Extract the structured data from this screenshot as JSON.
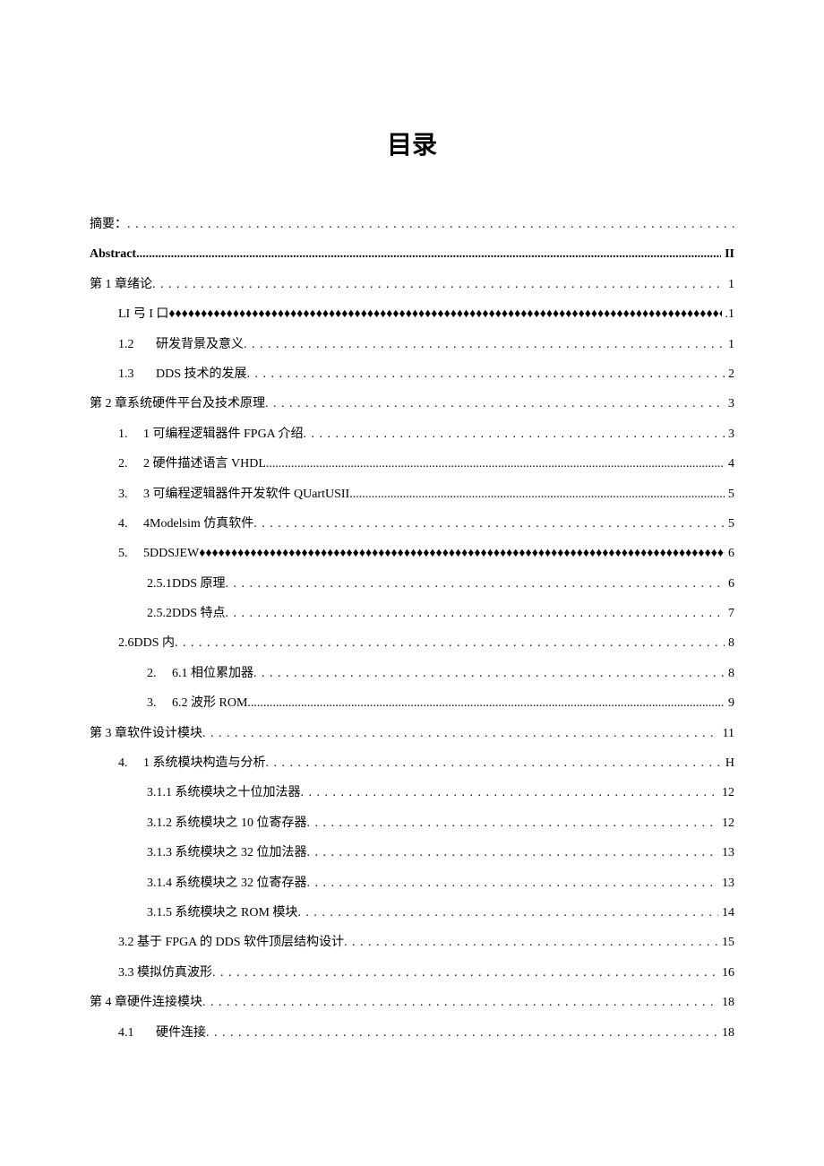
{
  "title": "目录",
  "entries": {
    "abstract_zh": "摘要：",
    "abstract_en": "Abstract",
    "abstract_en_page": "II",
    "ch1": "第 1 章绪论",
    "ch1_page": "1",
    "ch1_1": "LI 弓 I 口",
    "ch1_1_page": ".1",
    "ch1_2_num": "1.2",
    "ch1_2": "研发背景及意义",
    "ch1_2_page": "1",
    "ch1_3_num": "1.3",
    "ch1_3": "DDS 技术的发展",
    "ch1_3_page": "2",
    "ch2": "第 2 章系统硬件平台及技术原理",
    "ch2_page": "3",
    "ch2_1_num": "1.",
    "ch2_1": "1 可编程逻辑器件 FPGA 介绍",
    "ch2_1_page": "3",
    "ch2_2_num": "2.",
    "ch2_2": "2 硬件描述语言 VHDL",
    "ch2_2_page": "4",
    "ch2_3_num": "3.",
    "ch2_3": "3 可编程逻辑器件开发软件 QUartUSII",
    "ch2_3_page": "5",
    "ch2_4_num": "4.",
    "ch2_4": "4Modelsim 仿真软件",
    "ch2_4_page": "5",
    "ch2_5_num": "5.",
    "ch2_5": "5DDSJEW",
    "ch2_5_page": "6",
    "ch2_5_1": "2.5.1DDS 原理",
    "ch2_5_1_page": "6",
    "ch2_5_2": "2.5.2DDS 特点",
    "ch2_5_2_page": "7",
    "ch2_6": "2.6DDS 内",
    "ch2_6_page": "8",
    "ch2_6_1_num": "2.",
    "ch2_6_1": "6.1 相位累加器",
    "ch2_6_1_page": "8",
    "ch2_6_2_num": "3.",
    "ch2_6_2": "6.2 波形 ROM",
    "ch2_6_2_page": "9",
    "ch3": "第 3 章软件设计模块",
    "ch3_page": "11",
    "ch3_1_num": "4.",
    "ch3_1": "1 系统模块构造与分析",
    "ch3_1_page": "H",
    "ch3_1_1": "3.1.1 系统模块之十位加法器",
    "ch3_1_1_page": "12",
    "ch3_1_2": "3.1.2 系统模块之 10 位寄存器",
    "ch3_1_2_page": "12",
    "ch3_1_3": "3.1.3 系统模块之 32 位加法器",
    "ch3_1_3_page": "13",
    "ch3_1_4": "3.1.4 系统模块之 32 位寄存器",
    "ch3_1_4_page": "13",
    "ch3_1_5": "3.1.5 系统模块之 ROM 模块",
    "ch3_1_5_page": "14",
    "ch3_2": "3.2 基于 FPGA 的 DDS 软件顶层结构设计",
    "ch3_2_page": "15",
    "ch3_3": "3.3 模拟仿真波形",
    "ch3_3_page": "16",
    "ch4": "第 4 章硬件连接模块",
    "ch4_page": "18",
    "ch4_1_num": "4.1",
    "ch4_1": "硬件连接",
    "ch4_1_page": "18"
  }
}
